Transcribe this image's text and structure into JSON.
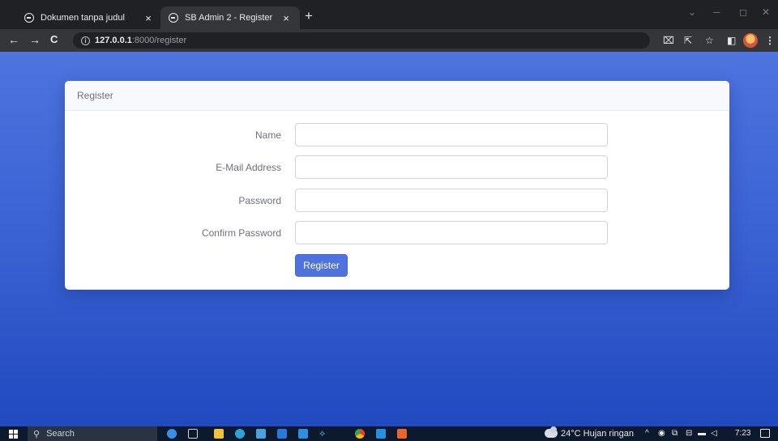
{
  "browser": {
    "tabs": [
      {
        "title": "Dokumen tanpa judul",
        "active": false
      },
      {
        "title": "SB Admin 2 - Register",
        "active": true
      }
    ],
    "close_glyph": "×",
    "new_tab_glyph": "+",
    "url_host": "127.0.0.1",
    "url_rest": ":8000/register",
    "icons": [
      "back-icon",
      "forward-icon",
      "reload-icon",
      "info-icon",
      "translate-icon",
      "share-icon",
      "star-icon",
      "sidepanel-icon",
      "profile-avatar",
      "menu-icon"
    ]
  },
  "page": {
    "background_gradient": [
      "#4e73df",
      "#224abe"
    ],
    "card": {
      "header": "Register",
      "fields": [
        {
          "label": "Name",
          "value": "",
          "type": "text"
        },
        {
          "label": "E-Mail Address",
          "value": "",
          "type": "email"
        },
        {
          "label": "Password",
          "value": "",
          "type": "password"
        },
        {
          "label": "Confirm Password",
          "value": "",
          "type": "password"
        }
      ],
      "submit_label": "Register",
      "accent": "#4e73df"
    }
  },
  "taskbar": {
    "search_placeholder": "Search",
    "weather": "24°C  Hujan ringan",
    "time": "7:23",
    "pinned_apps": [
      "edge-icon",
      "taskview-icon",
      "explorer-icon",
      "chrome-icon",
      "store-icon",
      "app-icon",
      "mail-icon",
      "figma-icon",
      "chrome-icon",
      "vscode-icon",
      "xampp-icon"
    ]
  }
}
